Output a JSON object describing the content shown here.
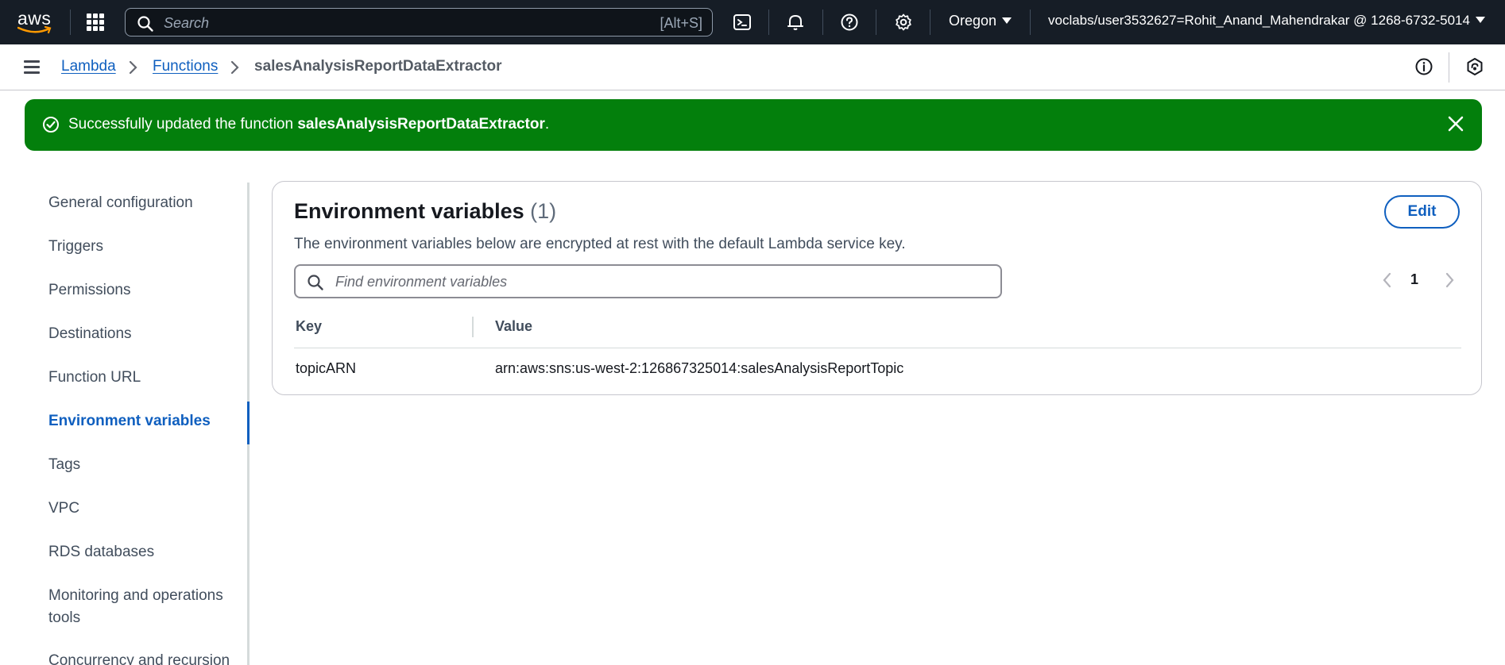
{
  "topnav": {
    "logo_text": "aws",
    "search_placeholder": "Search",
    "search_shortcut": "[Alt+S]",
    "region": "Oregon",
    "account": "voclabs/user3532627=Rohit_Anand_Mahendrakar @ 1268-6732-5014",
    "icons": [
      "apps-icon",
      "search-icon",
      "cloudshell-icon",
      "bell-icon",
      "help-icon",
      "gear-icon"
    ]
  },
  "breadcrumb": {
    "items": [
      "Lambda",
      "Functions"
    ],
    "current": "salesAnalysisReportDataExtractor"
  },
  "flash": {
    "prefix": "Successfully updated the function ",
    "function_name": "salesAnalysisReportDataExtractor",
    "suffix": ".",
    "color": "#037f0c"
  },
  "sidenav": {
    "items": [
      {
        "label": "General configuration"
      },
      {
        "label": "Triggers"
      },
      {
        "label": "Permissions"
      },
      {
        "label": "Destinations"
      },
      {
        "label": "Function URL"
      },
      {
        "label": "Environment variables",
        "active": true
      },
      {
        "label": "Tags"
      },
      {
        "label": "VPC"
      },
      {
        "label": "RDS databases"
      },
      {
        "label": "Monitoring and operations"
      },
      {
        "label": "tools"
      },
      {
        "label": "Concurrency and recursion"
      }
    ]
  },
  "panel": {
    "title": "Environment variables",
    "count": "(1)",
    "description": "The environment variables below are encrypted at rest with the default Lambda service key.",
    "edit_label": "Edit",
    "filter_placeholder": "Find environment variables",
    "page": "1",
    "columns": [
      "Key",
      "Value"
    ],
    "rows": [
      {
        "key": "topicARN",
        "value": "arn:aws:sns:us-west-2:126867325014:salesAnalysisReportTopic"
      }
    ]
  },
  "colors": {
    "accent": "#0f5fbf",
    "topnav_bg": "#161d26",
    "success": "#037f0c"
  }
}
